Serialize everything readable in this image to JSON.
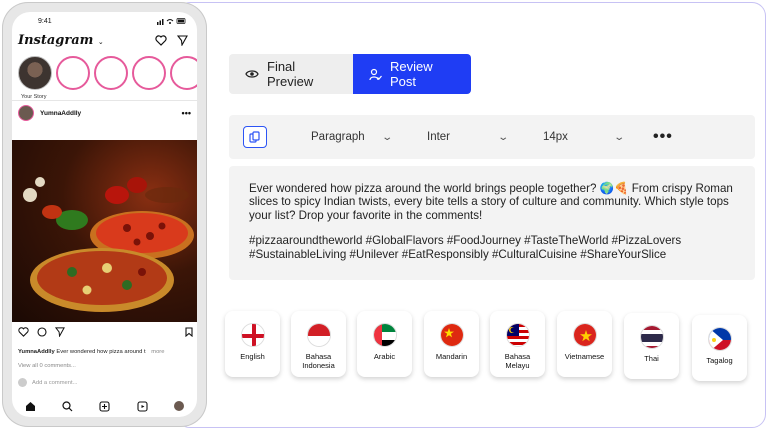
{
  "phone": {
    "status_time": "9:41",
    "app_name": "Instagram",
    "your_story_label": "Your Story",
    "post_username": "YumnaAddlly",
    "caption_user": "YumnaAddlly",
    "caption_text": "Ever wondered how pizza around t",
    "caption_more": "more",
    "view_comments": "View all 0 comments...",
    "add_comment": "Add a comment..."
  },
  "tabs": {
    "final_preview": "Final Preview",
    "review_post": "Review Post"
  },
  "toolbar": {
    "paragraph": "Paragraph",
    "font": "Inter",
    "size": "14px"
  },
  "post_text": {
    "body": "Ever wondered how pizza around the world brings people together? 🌍🍕 From crispy Roman slices to spicy Indian twists, every bite tells a story of culture and community. Which style tops your list? Drop your favorite in the comments!",
    "hashtags": "#pizzaaroundtheworld #GlobalFlavors #FoodJourney #TasteTheWorld #PizzaLovers #SustainableLiving #Unilever #EatResponsibly #CulturalCuisine #ShareYourSlice"
  },
  "languages": [
    {
      "label": "English"
    },
    {
      "label": "Bahasa Indonesia"
    },
    {
      "label": "Arabic"
    },
    {
      "label": "Mandarin"
    },
    {
      "label": "Bahasa Melayu"
    },
    {
      "label": "Vietnamese"
    },
    {
      "label": "Thai"
    },
    {
      "label": "Tagalog"
    }
  ],
  "colors": {
    "accent": "#1f3df4",
    "card_border": "#c7c2f4",
    "story_ring": "#e65a9b"
  }
}
